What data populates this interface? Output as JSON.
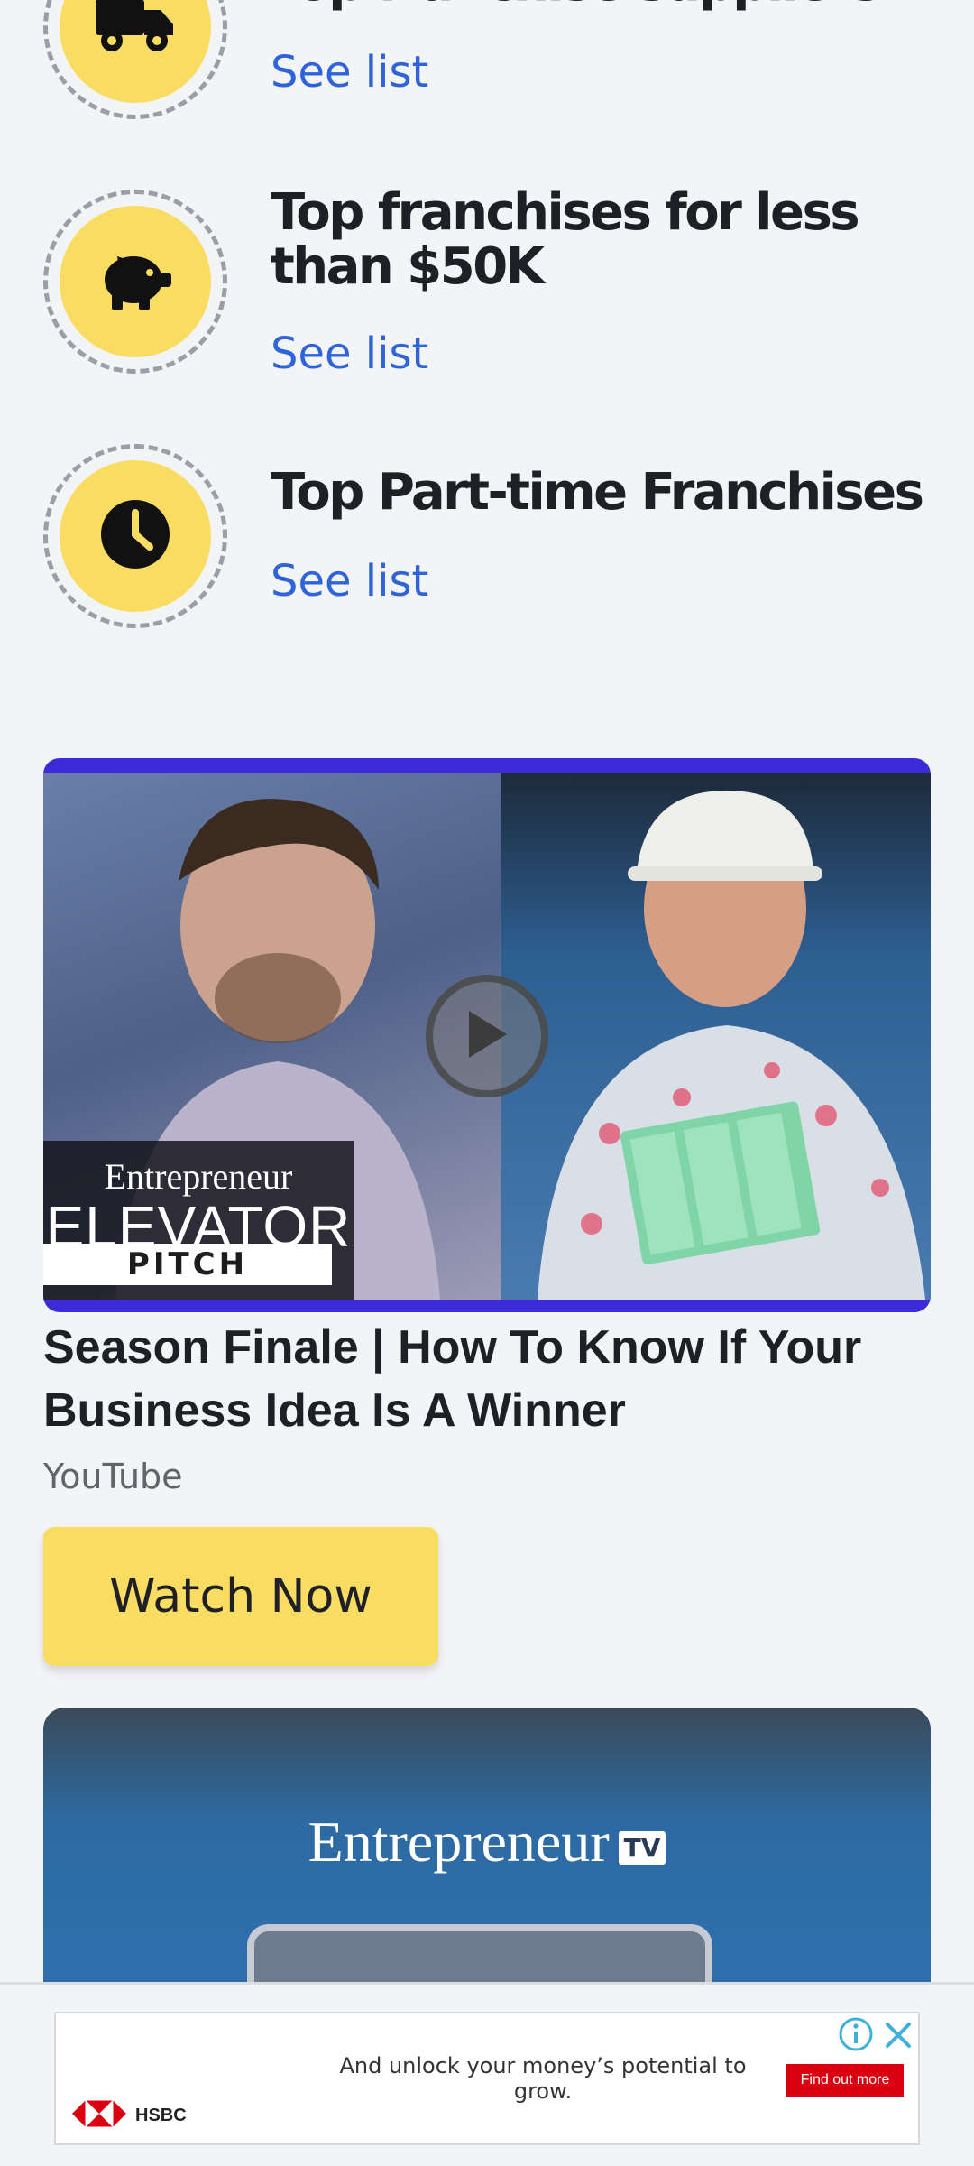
{
  "list": {
    "items": [
      {
        "title": "Top franchise suppliers",
        "link": "See list",
        "icon": "truck-icon"
      },
      {
        "title": "Top franchises for less than $50K",
        "link": "See list",
        "icon": "piggy-bank-icon"
      },
      {
        "title": "Top Part-time Franchises",
        "link": "See list",
        "icon": "clock-icon"
      }
    ]
  },
  "video": {
    "logo_brand": "Entrepreneur",
    "logo_main": "ELEVATOR",
    "logo_pitch": "PITCH",
    "title": "Season Finale | How To Know If Your Business Idea Is A Winner",
    "source": "YouTube",
    "cta": "Watch Now",
    "play_icon": "play-icon"
  },
  "next_card": {
    "brand": "Entrepreneur",
    "badge": "TV"
  },
  "ad": {
    "text": "And unlock your money’s potential to grow.",
    "cta": "Find out more",
    "brand": "HSBC",
    "info_icon": "info-icon",
    "close_icon": "close-icon"
  },
  "colors": {
    "accent_yellow": "#f9dc62",
    "link_blue": "#2f63d8",
    "video_border": "#3b2bd8",
    "ad_red": "#db0011"
  }
}
